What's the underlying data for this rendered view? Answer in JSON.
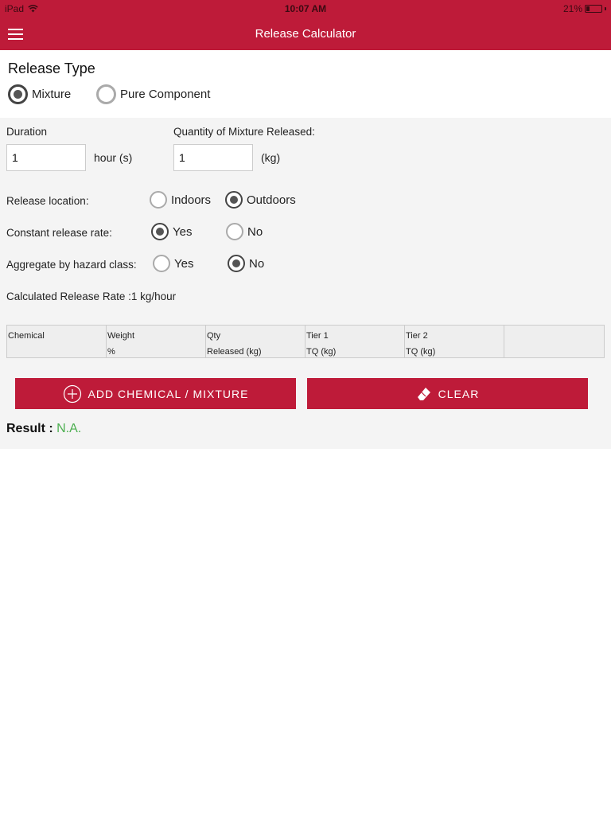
{
  "status_bar": {
    "carrier": "iPad",
    "time": "10:07 AM",
    "battery": "21%",
    "battery_level": 0.21
  },
  "header": {
    "title": "Release Calculator",
    "menu_icon": "hamburger-menu-icon"
  },
  "release_type": {
    "title": "Release Type",
    "options": [
      {
        "label": "Mixture",
        "selected": true
      },
      {
        "label": "Pure Component",
        "selected": false
      }
    ]
  },
  "duration": {
    "label": "Duration",
    "value": "1",
    "unit": "hour (s)"
  },
  "quantity": {
    "label": "Quantity of Mixture Released:",
    "value": "1",
    "unit": "(kg)"
  },
  "release_location": {
    "label": "Release location:",
    "options": [
      {
        "label": "Indoors",
        "selected": false
      },
      {
        "label": "Outdoors",
        "selected": true
      }
    ]
  },
  "constant_rate": {
    "label": "Constant release rate:",
    "options": [
      {
        "label": "Yes",
        "selected": true
      },
      {
        "label": "No",
        "selected": false
      }
    ]
  },
  "aggregate": {
    "label": "Aggregate by hazard class:",
    "options": [
      {
        "label": "Yes",
        "selected": false
      },
      {
        "label": "No",
        "selected": true
      }
    ]
  },
  "calculated_rate": "Calculated Release Rate :1 kg/hour",
  "table": {
    "columns": [
      {
        "line1": "Chemical",
        "line2": ""
      },
      {
        "line1": "Weight",
        "line2": "%"
      },
      {
        "line1": "Qty",
        "line2": "Released (kg)"
      },
      {
        "line1": "Tier 1",
        "line2": "TQ (kg)"
      },
      {
        "line1": "Tier 2",
        "line2": "TQ (kg)"
      },
      {
        "line1": "",
        "line2": ""
      }
    ]
  },
  "buttons": {
    "add_label": "ADD CHEMICAL / MIXTURE",
    "clear_label": "CLEAR"
  },
  "result": {
    "label": "Result :",
    "value": "N.A."
  },
  "colors": {
    "brand": "#be1b39",
    "result_value": "#4caf50",
    "form_bg": "#f4f4f4"
  }
}
